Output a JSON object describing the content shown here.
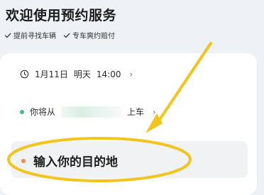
{
  "header": {
    "title": "欢迎使用预约服务",
    "features": [
      {
        "icon": "check-icon",
        "label": "提前寻找车辆"
      },
      {
        "icon": "check-icon",
        "label": "专车爽约赔付"
      }
    ]
  },
  "booking": {
    "time": {
      "icon": "clock-icon",
      "date": "1月11日",
      "day": "明天",
      "clock": "14:00",
      "chevron": "›"
    },
    "pickup": {
      "prefix": "你将从",
      "suffix": "上车",
      "chevron": "›"
    },
    "destination": {
      "placeholder": "输入你的目的地"
    }
  },
  "colors": {
    "page_bg": "#eef1f5",
    "card_bg": "#ffffff",
    "pickup_dot": "#4bb58e",
    "destination_dot": "#ee8a58",
    "annotation": "#f1c21b"
  }
}
